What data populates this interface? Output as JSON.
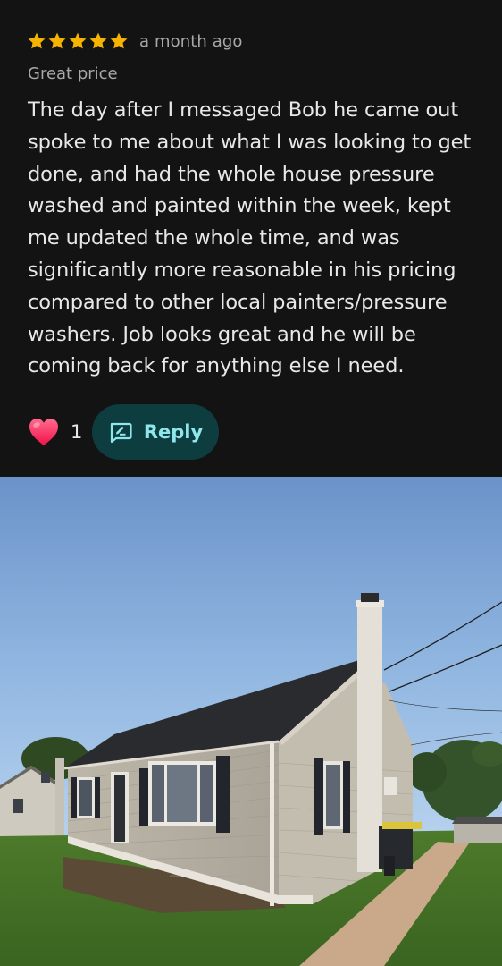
{
  "review": {
    "rating": 5,
    "rating_max": 5,
    "time_ago": "a month ago",
    "subtitle": "Great price",
    "text": "The day after I messaged Bob he came out spoke to me about what I was looking to get done, and had the whole house pressure washed and painted within the week, kept me updated the whole time, and was significantly more reasonable in his pricing compared to other local painters/pressure washers. Job looks great and he will be coming back for anything else I need.",
    "like_count": "1",
    "reply_label": "Reply"
  },
  "colors": {
    "background": "#131314",
    "star": "#f6b400",
    "reply_button_bg": "#0e3d3f",
    "reply_accent": "#8ee7ec",
    "heart": "#ff2e63"
  },
  "icons": {
    "star": "star-icon",
    "heart": "heart-icon",
    "reply": "reply-icon"
  }
}
